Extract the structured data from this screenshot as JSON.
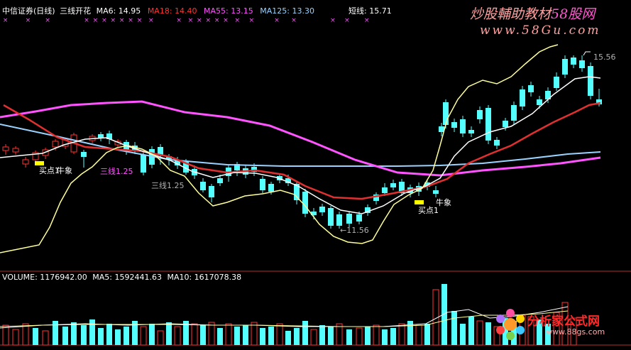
{
  "header": {
    "title": "中信证券(日线)",
    "indicator": "三线开花",
    "ma6": "MA6: 14.95",
    "ma18": "MA18: 14.40",
    "ma55": "MA55: 13.15",
    "ma125": "MA125: 13.30",
    "short": "短线: 15.71"
  },
  "watermark": {
    "line1": "炒股輔助教材",
    "line1_suffix": "58股网",
    "url": "www.58Gu.com",
    "badge": "分析家公式网",
    "badge_url": "www.88gs.com"
  },
  "annotations": {
    "buy1_left": "买点1",
    "bull_left": "牛象",
    "three_lines_left": "三线1.25",
    "three_lines_mid": "三线1.25",
    "low_mark": "←11.56",
    "buy1_right": "买点1",
    "bull_right": "牛象",
    "high_mark": "15.56"
  },
  "volume_header": {
    "volume": "VOLUME: 1176942.00",
    "ma5": "MA5: 1592441.63",
    "ma10": "MA10: 1617078.38"
  },
  "colors": {
    "up": "#ff3232",
    "down": "#54ffff",
    "ma6": "#ffffff",
    "ma18": "#ff3232",
    "ma55": "#ff54ff",
    "ma125": "#9ad2ff",
    "short": "#ffff99",
    "watermark": "#ffa0a0"
  }
}
